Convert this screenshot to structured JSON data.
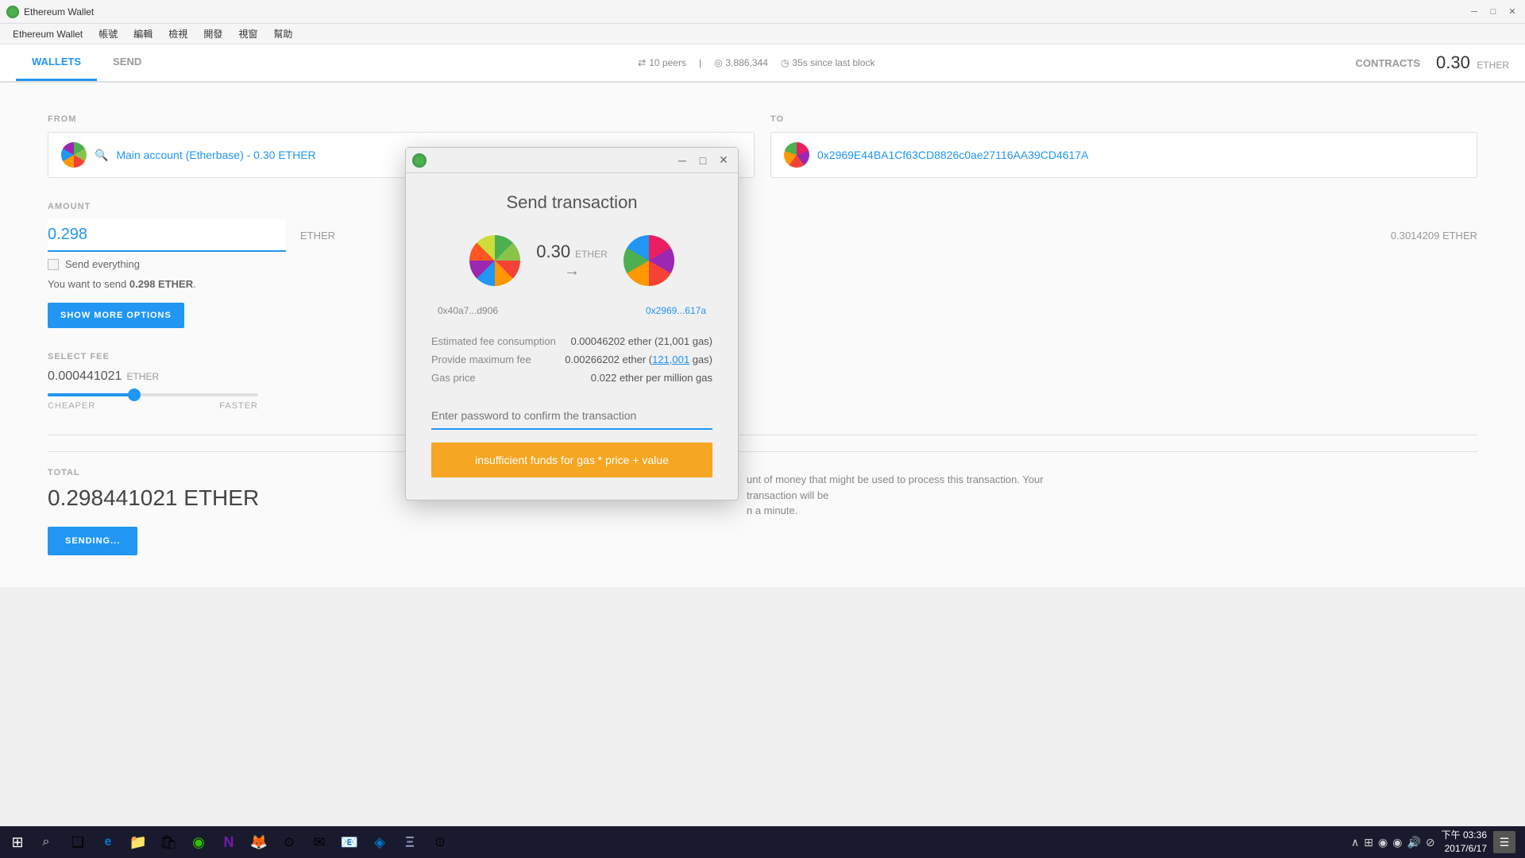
{
  "app": {
    "title": "Ethereum Wallet",
    "icon_color": "#4caf50"
  },
  "menubar": {
    "items": [
      "帳號",
      "編輯",
      "檢視",
      "開發",
      "視窗",
      "幫助"
    ]
  },
  "navbar": {
    "tabs": [
      {
        "label": "WALLETS",
        "active": true
      },
      {
        "label": "SEND",
        "active": false
      }
    ],
    "status": {
      "peers_icon": "⇄",
      "peers": "10 peers",
      "blocks_icon": "◎",
      "blocks": "3,886,344",
      "time_icon": "◷",
      "time": "35s since last block"
    },
    "contracts": "CONTRACTS",
    "balance": "0.30",
    "balance_unit": "ETHER"
  },
  "main": {
    "from_label": "FROM",
    "to_label": "TO",
    "from_account": "Main account (Etherbase) - 0.30 ETHER",
    "to_address": "0x2969E44BA1Cf63CD8826c0ae27116AA39CD4617A",
    "amount_label": "AMOUNT",
    "amount_value": "0.298",
    "send_everything_label": "Send everything",
    "you_want_text": "You want to send ",
    "you_want_amount": "0.298 ETHER",
    "you_want_period": ".",
    "show_more_btn": "SHOW MORE OPTIONS",
    "max_balance": "0.3014209 ETHER",
    "fee_label": "SELECT FEE",
    "fee_value": "0.000441021",
    "fee_unit": "ETHER",
    "fee_slider_min": "CHEAPER",
    "fee_slider_max": "FASTER",
    "total_label": "TOTAL",
    "total_value": "0.298441021 ETHER",
    "sending_btn": "SENDING..."
  },
  "modal": {
    "title": "Send transaction",
    "from_avatar_color1": "#4CAF50",
    "from_avatar_color2": "#F44336",
    "to_avatar_color1": "#E91E63",
    "to_avatar_color2": "#9C27B0",
    "transfer_amount": "0.30",
    "transfer_unit": "ETHER",
    "from_short": "0x40a7...d906",
    "to_short": "0x2969...617a",
    "fee_rows": [
      {
        "label": "Estimated fee consumption",
        "value": "0.00046202 ether (21,001 gas)"
      },
      {
        "label": "Provide maximum fee",
        "value": "0.00266202 ether (121,001 gas)"
      },
      {
        "label": "Gas price",
        "value": "0.022 ether per million gas"
      }
    ],
    "max_fee_link": "121,001",
    "password_placeholder": "Enter password to confirm the transaction",
    "error_btn": "insufficient funds for gas * price + value"
  },
  "taskbar": {
    "start_icon": "⊞",
    "search_icon": "⌕",
    "apps": [
      {
        "name": "task-view-icon",
        "symbol": "❑"
      },
      {
        "name": "edge-icon",
        "symbol": "e"
      },
      {
        "name": "explorer-icon",
        "symbol": "📁"
      },
      {
        "name": "store-icon",
        "symbol": "🛍"
      },
      {
        "name": "wechat-icon",
        "symbol": "💬"
      },
      {
        "name": "onenote-icon",
        "symbol": "N"
      },
      {
        "name": "firefox-icon",
        "symbol": "🦊"
      },
      {
        "name": "chrome-icon-1",
        "symbol": "⊙"
      },
      {
        "name": "outlook-icon",
        "symbol": "✉"
      },
      {
        "name": "mail-icon",
        "symbol": "📧"
      },
      {
        "name": "vscode-icon",
        "symbol": "◈"
      },
      {
        "name": "ethereum-icon",
        "symbol": "Ξ"
      },
      {
        "name": "chrome-icon-2",
        "symbol": "⊙"
      }
    ],
    "tray": {
      "show_hidden": "∧",
      "network_icon": "⊞",
      "icon2": "◉",
      "icon3": "◉",
      "icon4": "🔊",
      "icon5": "⊘"
    },
    "time": "下午 03:36",
    "date": "2017/6/17",
    "notification_icon": "☰"
  }
}
